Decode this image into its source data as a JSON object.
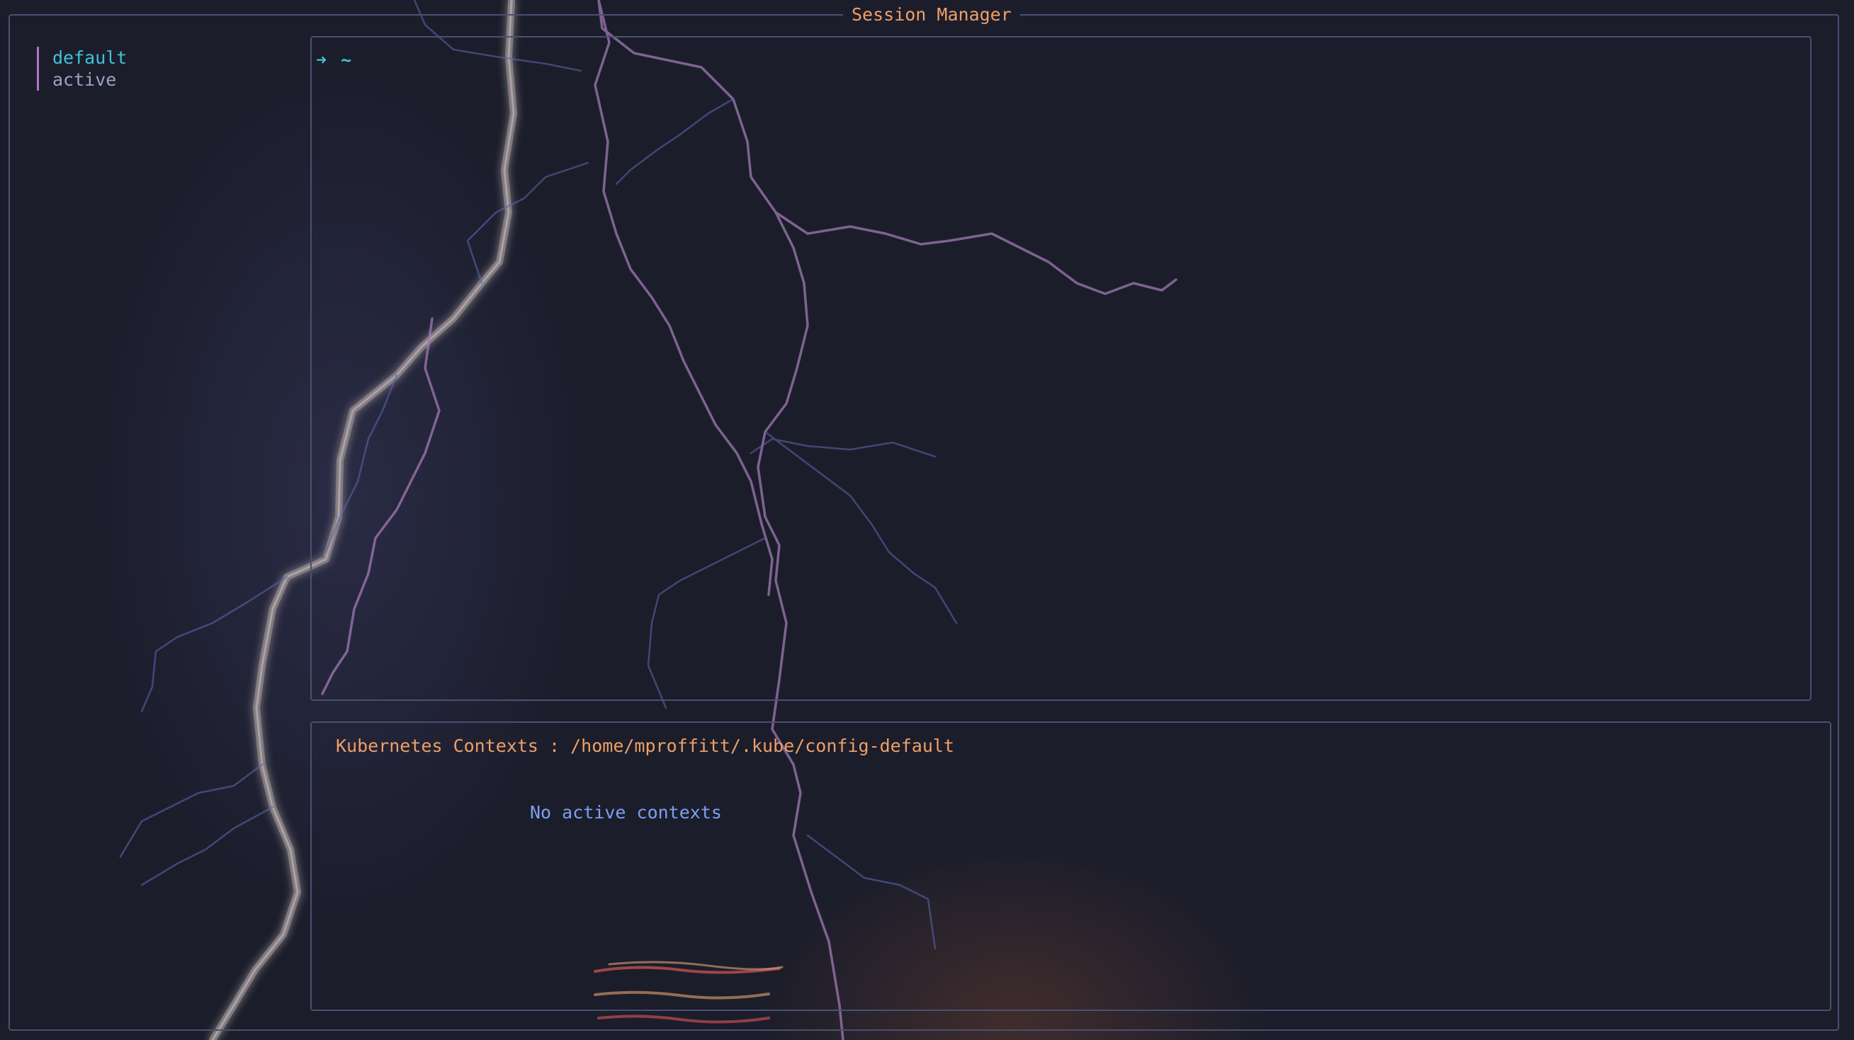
{
  "window": {
    "title": "Session Manager"
  },
  "sessions": {
    "items": [
      {
        "name": "default",
        "state": "selected"
      },
      {
        "name": "active",
        "state": "normal"
      }
    ]
  },
  "terminal": {
    "prompt_symbol": "➜",
    "cwd": "~"
  },
  "kubernetes": {
    "title": "Kubernetes Contexts : /home/mproffitt/.kube/config-default",
    "empty_message": "No active contexts"
  },
  "colors": {
    "background": "#1b1d2b",
    "border": "#4a5070",
    "title": "#ef9f65",
    "selected_session": "#3fc3d8",
    "session_text": "#9aa2c4",
    "session_marker": "#b773c7",
    "empty_message": "#7d9ff0"
  }
}
